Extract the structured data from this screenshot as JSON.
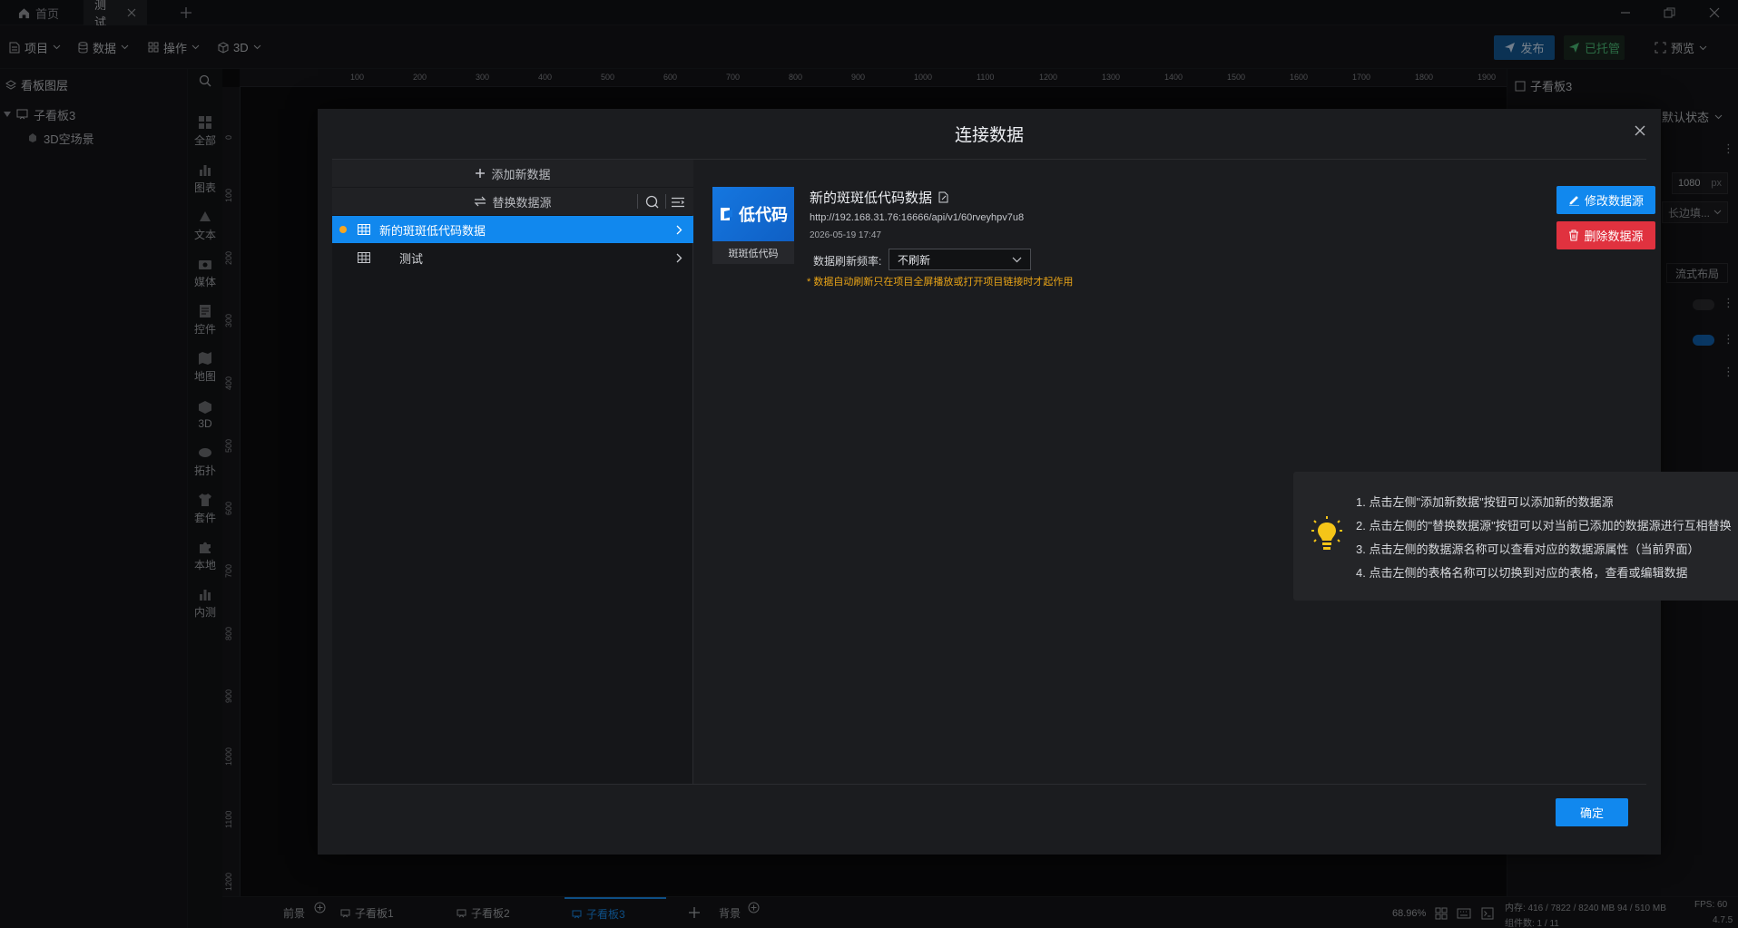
{
  "tabs": [
    {
      "label": "首页",
      "icon": "home-icon"
    },
    {
      "label": "测试",
      "icon": "close-icon"
    }
  ],
  "toolbar": {
    "project": "项目",
    "data": "数据",
    "operation": "操作",
    "threed": "3D",
    "publish": "发布",
    "hosted": "已托管",
    "preview": "预览"
  },
  "layers": {
    "title": "看板图层",
    "board": "子看板3",
    "scene": "3D空场景"
  },
  "components": [
    "全部",
    "图表",
    "文本",
    "媒体",
    "控件",
    "地图",
    "3D",
    "拓扑",
    "套件",
    "本地",
    "内测"
  ],
  "ruler": {
    "top": [
      "100",
      "200",
      "300",
      "400",
      "500",
      "600",
      "700",
      "800",
      "900",
      "1000",
      "1100",
      "1200",
      "1300",
      "1400",
      "1500",
      "1600",
      "1700",
      "1800",
      "1900"
    ],
    "left": [
      "0",
      "100",
      "200",
      "300",
      "400",
      "500",
      "600",
      "700",
      "800",
      "900",
      "1000",
      "1100",
      "1200"
    ]
  },
  "rightpanel": {
    "title": "子看板3",
    "state": "默认状态",
    "height_value": "1080",
    "unit": "px",
    "fill_select": "长边填...",
    "layout": "流式布局"
  },
  "bottom": {
    "foreground": "前景",
    "boards": [
      "子看板1",
      "子看板2",
      "子看板3"
    ],
    "background": "背景",
    "zoom": "68.96%",
    "memory": "内存: 416 / 7822 / 8240 MB  94 / 510 MB",
    "fps": "FPS: 60",
    "count": "组件数: 1 / 11",
    "version": "4.7.5"
  },
  "modal": {
    "title": "连接数据",
    "add_new": "添加新数据",
    "replace": "替换数据源",
    "sources": [
      {
        "name": "新的斑斑低代码数据",
        "active": true
      },
      {
        "name": "测试",
        "active": false
      }
    ],
    "logo_text": "低代码",
    "logo_caption": "斑斑低代码",
    "source_name": "新的斑斑低代码数据",
    "url": "http://192.168.31.76:16666/api/v1/60rveyhpv7u8",
    "date": "2026-05-19 17:47",
    "refresh_label": "数据刷新频率:",
    "refresh_value": "不刷新",
    "refresh_note": "* 数据自动刷新只在项目全屏播放或打开项目链接时才起作用",
    "edit_btn": "修改数据源",
    "delete_btn": "删除数据源",
    "tips": [
      "1. 点击左侧\"添加新数据\"按钮可以添加新的数据源",
      "2. 点击左侧的\"替换数据源\"按钮可以对当前已添加的数据源进行互相替换",
      "3. 点击左侧的数据源名称可以查看对应的数据源属性（当前界面）",
      "4. 点击左侧的表格名称可以切换到对应的表格，查看或编辑数据"
    ],
    "confirm": "确定"
  },
  "colors": {
    "accent": "#1188ee",
    "danger": "#e0323f",
    "active_dot": "#f5a623",
    "note": "#e8a317",
    "tip_icon": "#f5c518"
  }
}
